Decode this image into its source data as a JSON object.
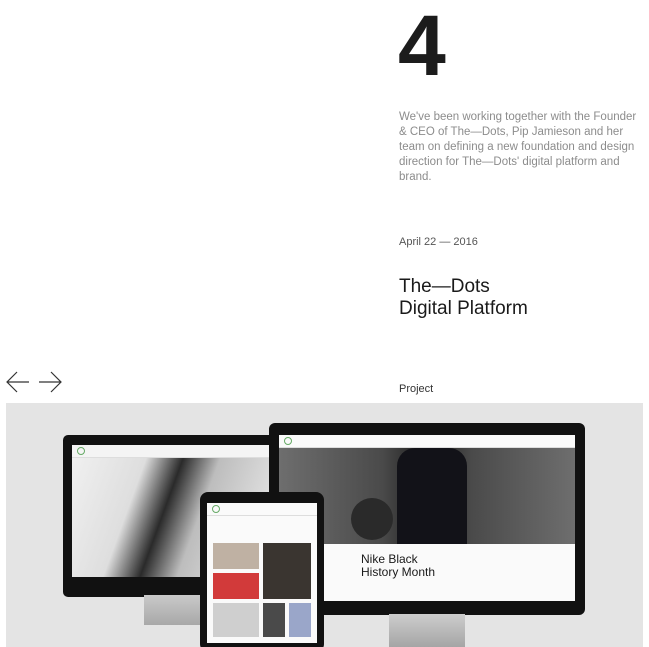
{
  "project": {
    "number": "4",
    "description": "We've been working together with the Founder & CEO of The—Dots, Pip Jamieson and her team on defining a new foundation and design direction for The—Dots' digital platform and brand.",
    "date": "April 22 — 2016",
    "title_line1": "The—Dots",
    "title_line2": "Digital Platform",
    "category": "Project"
  },
  "nav": {
    "prev_icon": "arrow-left-icon",
    "next_icon": "arrow-right-icon"
  },
  "hero": {
    "headline_line1": "Nike Black",
    "headline_line2": "History Month",
    "background_color": "#e4e4e4"
  }
}
